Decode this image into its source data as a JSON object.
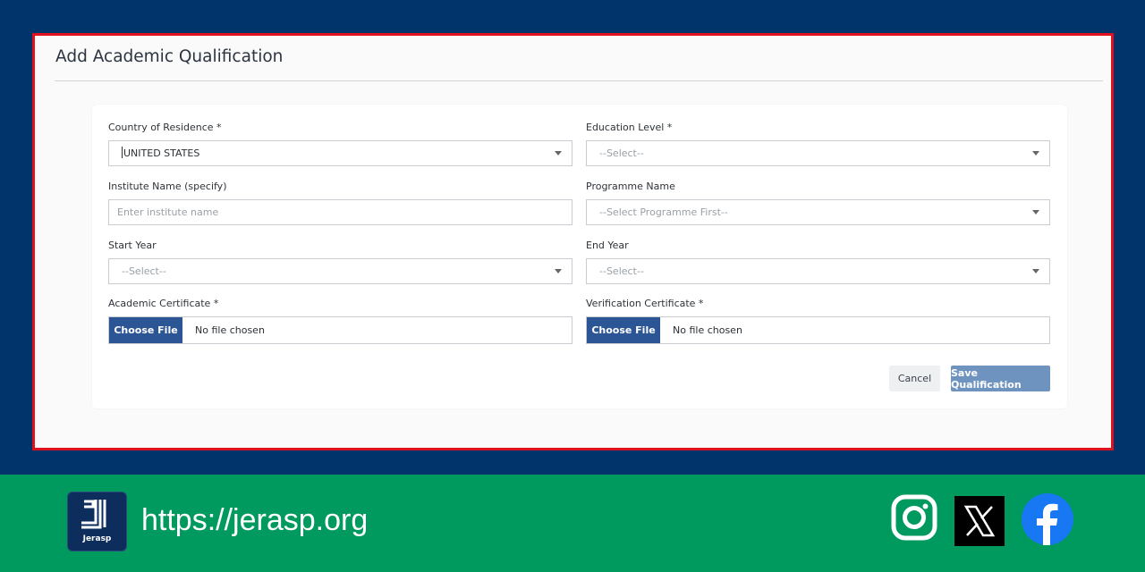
{
  "form": {
    "title": "Add Academic Qualification",
    "country": {
      "label": "Country of Residence *",
      "value": "UNITED STATES"
    },
    "education_level": {
      "label": "Education Level *",
      "value": "--Select--"
    },
    "institute": {
      "label": "Institute Name (specify)",
      "placeholder": "Enter institute name"
    },
    "programme": {
      "label": "Programme Name",
      "value": "--Select Programme First--"
    },
    "start_year": {
      "label": "Start Year",
      "value": "--Select--"
    },
    "end_year": {
      "label": "End Year",
      "value": "--Select--"
    },
    "academic_certificate": {
      "label": "Academic Certificate *",
      "button": "Choose File",
      "status": "No file chosen"
    },
    "verification_certificate": {
      "label": "Verification Certificate *",
      "button": "Choose File",
      "status": "No file chosen"
    },
    "cancel_label": "Cancel",
    "save_label": "Save Qualification"
  },
  "footer": {
    "logo_text": "Jerasp",
    "url": "https://jerasp.org",
    "social_icons": [
      "instagram-icon",
      "x-icon",
      "facebook-icon"
    ]
  },
  "colors": {
    "background": "#00346b",
    "frame_border": "#e0101c",
    "footer": "#009a5e",
    "primary_button": "#2b5594",
    "save_button": "#6f93bf"
  }
}
